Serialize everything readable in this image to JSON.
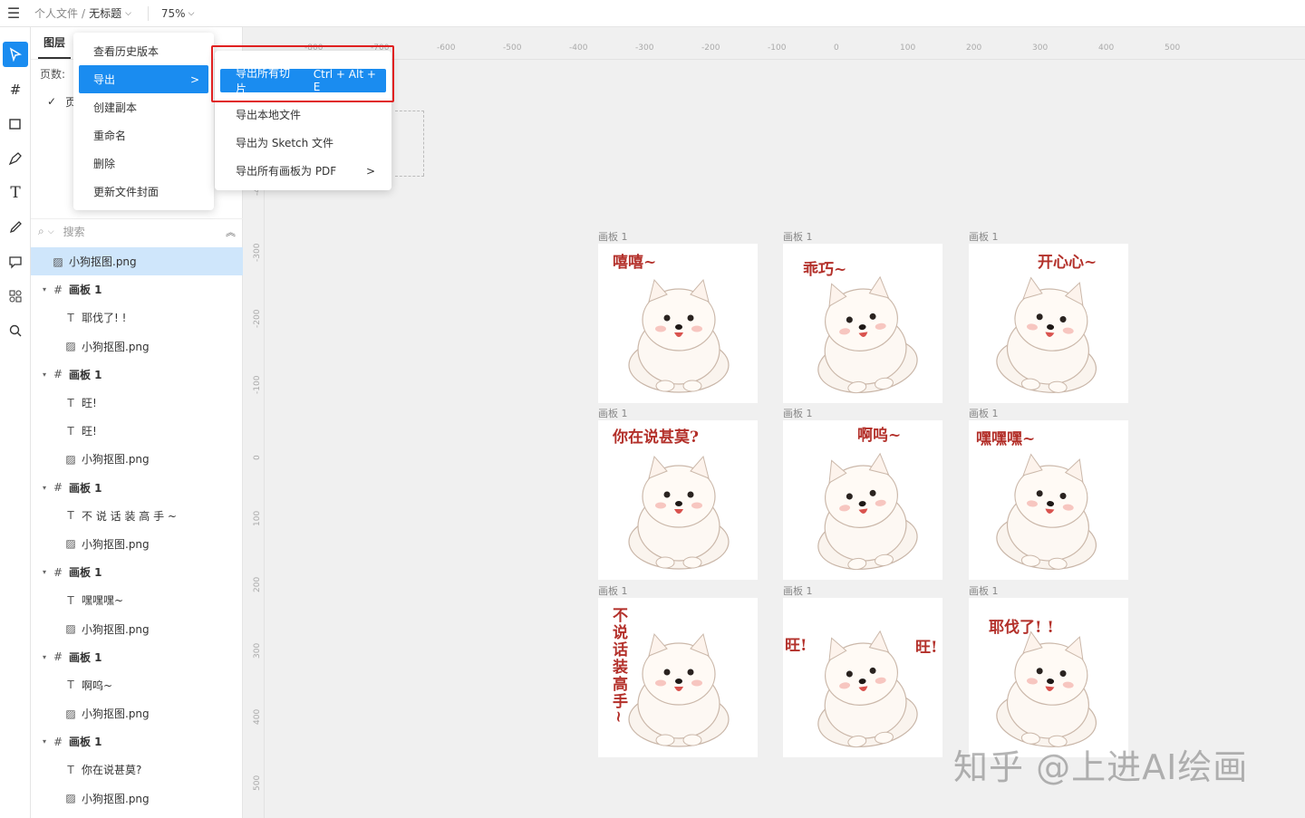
{
  "topbar": {
    "menu_icon": "menu-icon",
    "crumb_parent": "个人文件",
    "crumb_sep": "/",
    "crumb_current": "无标题",
    "zoom": "75%"
  },
  "toolbar": {
    "tools": [
      "select-icon",
      "frame-icon",
      "rectangle-icon",
      "pen-icon",
      "text-icon",
      "pencil-icon",
      "comment-icon",
      "components-icon",
      "search-icon"
    ]
  },
  "panel": {
    "tab": "图层",
    "pages_label": "页数:",
    "page_item": "页",
    "search_placeholder": "搜索",
    "layers": [
      {
        "type": "image",
        "label": "小狗抠图.png",
        "indent": 0,
        "selected": true
      },
      {
        "type": "frame",
        "label": "画板 1",
        "indent": 0
      },
      {
        "type": "text",
        "label": "耶伐了! !",
        "indent": 1
      },
      {
        "type": "image",
        "label": "小狗抠图.png",
        "indent": 1
      },
      {
        "type": "frame",
        "label": "画板 1",
        "indent": 0
      },
      {
        "type": "text",
        "label": "旺!",
        "indent": 1
      },
      {
        "type": "text",
        "label": "旺!",
        "indent": 1
      },
      {
        "type": "image",
        "label": "小狗抠图.png",
        "indent": 1
      },
      {
        "type": "frame",
        "label": "画板 1",
        "indent": 0
      },
      {
        "type": "text",
        "label": "不 说 话 装 高 手 ~",
        "indent": 1
      },
      {
        "type": "image",
        "label": "小狗抠图.png",
        "indent": 1
      },
      {
        "type": "frame",
        "label": "画板 1",
        "indent": 0
      },
      {
        "type": "text",
        "label": "嘿嘿嘿~",
        "indent": 1
      },
      {
        "type": "image",
        "label": "小狗抠图.png",
        "indent": 1
      },
      {
        "type": "frame",
        "label": "画板 1",
        "indent": 0
      },
      {
        "type": "text",
        "label": "啊呜~",
        "indent": 1
      },
      {
        "type": "image",
        "label": "小狗抠图.png",
        "indent": 1
      },
      {
        "type": "frame",
        "label": "画板 1",
        "indent": 0
      },
      {
        "type": "text",
        "label": "你在说甚莫?",
        "indent": 1
      },
      {
        "type": "image",
        "label": "小狗抠图.png",
        "indent": 1
      }
    ]
  },
  "menu": {
    "items": [
      "查看历史版本",
      "导出",
      "创建副本",
      "重命名",
      "删除",
      "更新文件封面"
    ],
    "submenu_arrow": ">",
    "sub": {
      "primary": "导出所有切片",
      "shortcut": "Ctrl + Alt + E",
      "items": [
        "导出本地文件",
        "导出为 Sketch 文件",
        "导出所有画板为 PDF"
      ],
      "pdf_arrow": ">"
    }
  },
  "ruler": {
    "top": [
      "-800",
      "-700",
      "-600",
      "-500",
      "-400",
      "-300",
      "-200",
      "-100",
      "0",
      "100",
      "200",
      "300",
      "400",
      "500"
    ],
    "left": [
      "-400",
      "-300",
      "-200",
      "-100",
      "0",
      "100",
      "200",
      "300",
      "400",
      "500"
    ]
  },
  "boards": [
    {
      "label": "画板 1",
      "caption": "嘻嘻~"
    },
    {
      "label": "画板 1",
      "caption": "乖巧~"
    },
    {
      "label": "画板 1",
      "caption": "开心心~"
    },
    {
      "label": "画板 1",
      "caption": "你在说甚莫?"
    },
    {
      "label": "画板 1",
      "caption": "啊呜~"
    },
    {
      "label": "画板 1",
      "caption": "嘿嘿嘿~"
    },
    {
      "label": "画板 1",
      "caption": "不说话装高手~"
    },
    {
      "label": "画板 1",
      "caption": "旺!",
      "caption2": "旺!"
    },
    {
      "label": "画板 1",
      "caption": "耶伐了! !"
    }
  ],
  "watermark": "知乎 @上进AI绘画"
}
